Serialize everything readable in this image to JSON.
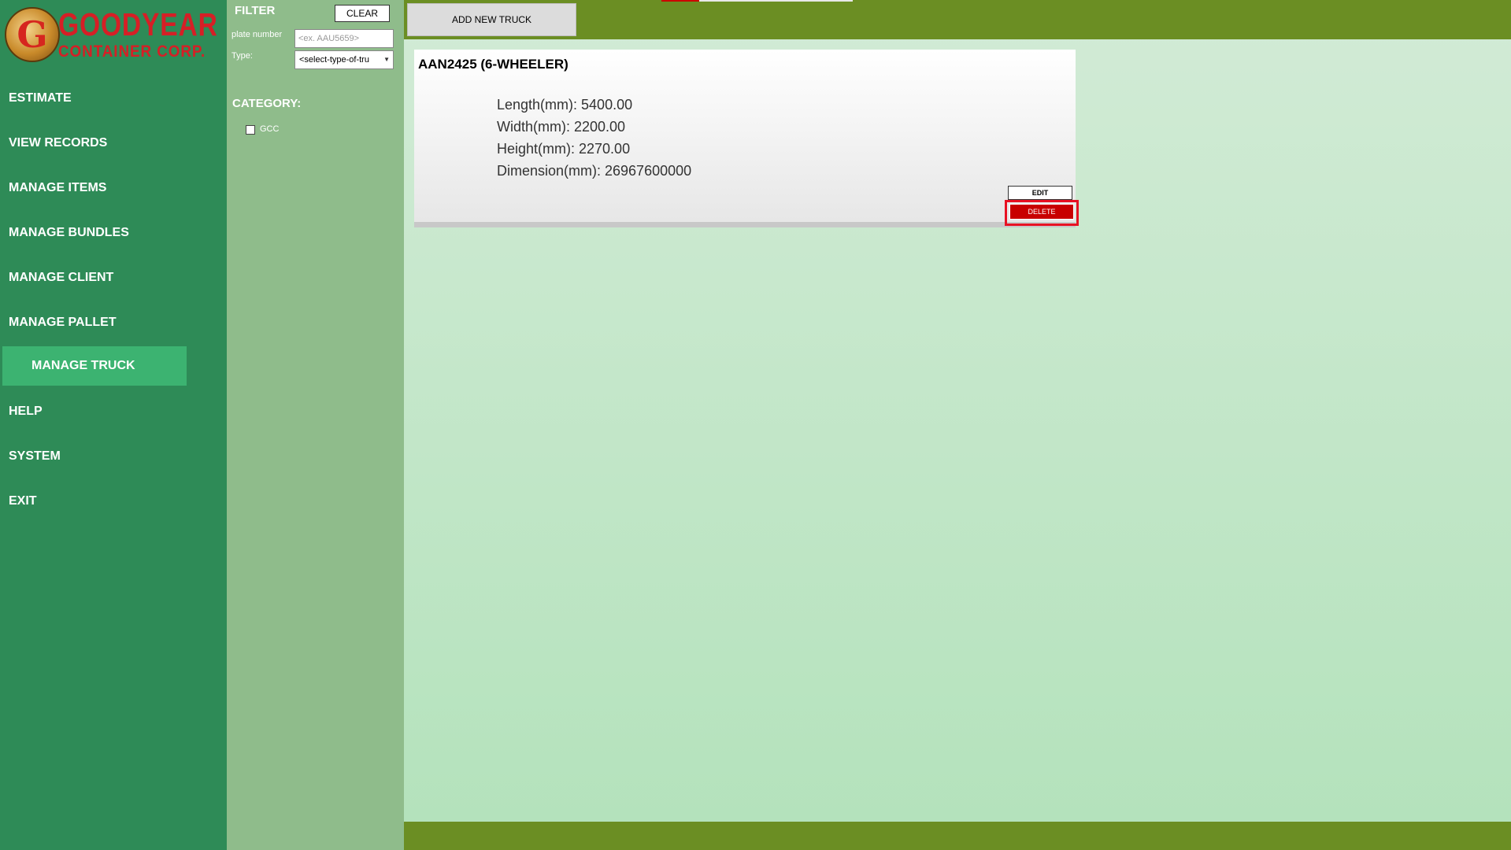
{
  "brand": {
    "logo_letter": "G",
    "line1": "GOODYEAR",
    "line2": "CONTAINER CORP."
  },
  "sidebar": {
    "items": [
      {
        "label": "ESTIMATE"
      },
      {
        "label": "VIEW RECORDS"
      },
      {
        "label": "MANAGE ITEMS"
      },
      {
        "label": "MANAGE BUNDLES"
      },
      {
        "label": "MANAGE CLIENT"
      },
      {
        "label": "MANAGE PALLET"
      },
      {
        "label": "MANAGE TRUCK",
        "active": true
      },
      {
        "label": "HELP"
      },
      {
        "label": "SYSTEM"
      },
      {
        "label": "EXIT"
      }
    ]
  },
  "filter": {
    "title": "FILTER",
    "clear_label": "CLEAR",
    "plate_label": "plate number",
    "plate_placeholder": "<ex. AAU5659>",
    "plate_value": "",
    "type_label": "Type:",
    "type_selected": "<select-type-of-tru",
    "category_title": "CATEGORY:",
    "categories": [
      {
        "label": "GCC",
        "checked": false
      }
    ]
  },
  "toolbar": {
    "add_truck_label": "ADD NEW TRUCK"
  },
  "truck": {
    "title": "AAN2425 (6-WHEELER)",
    "length": "Length(mm): 5400.00",
    "width": "Width(mm): 2200.00",
    "height": "Height(mm): 2270.00",
    "dimension": "Dimension(mm): 26967600000",
    "edit_label": "EDIT",
    "delete_label": "DELETE"
  },
  "colors": {
    "sidebar": "#2e8b57",
    "sidebar_active": "#3cb371",
    "filter_panel": "#8fbc8b",
    "topbar": "#6b8e23",
    "delete": "#c80000",
    "highlight": "#e81123"
  }
}
